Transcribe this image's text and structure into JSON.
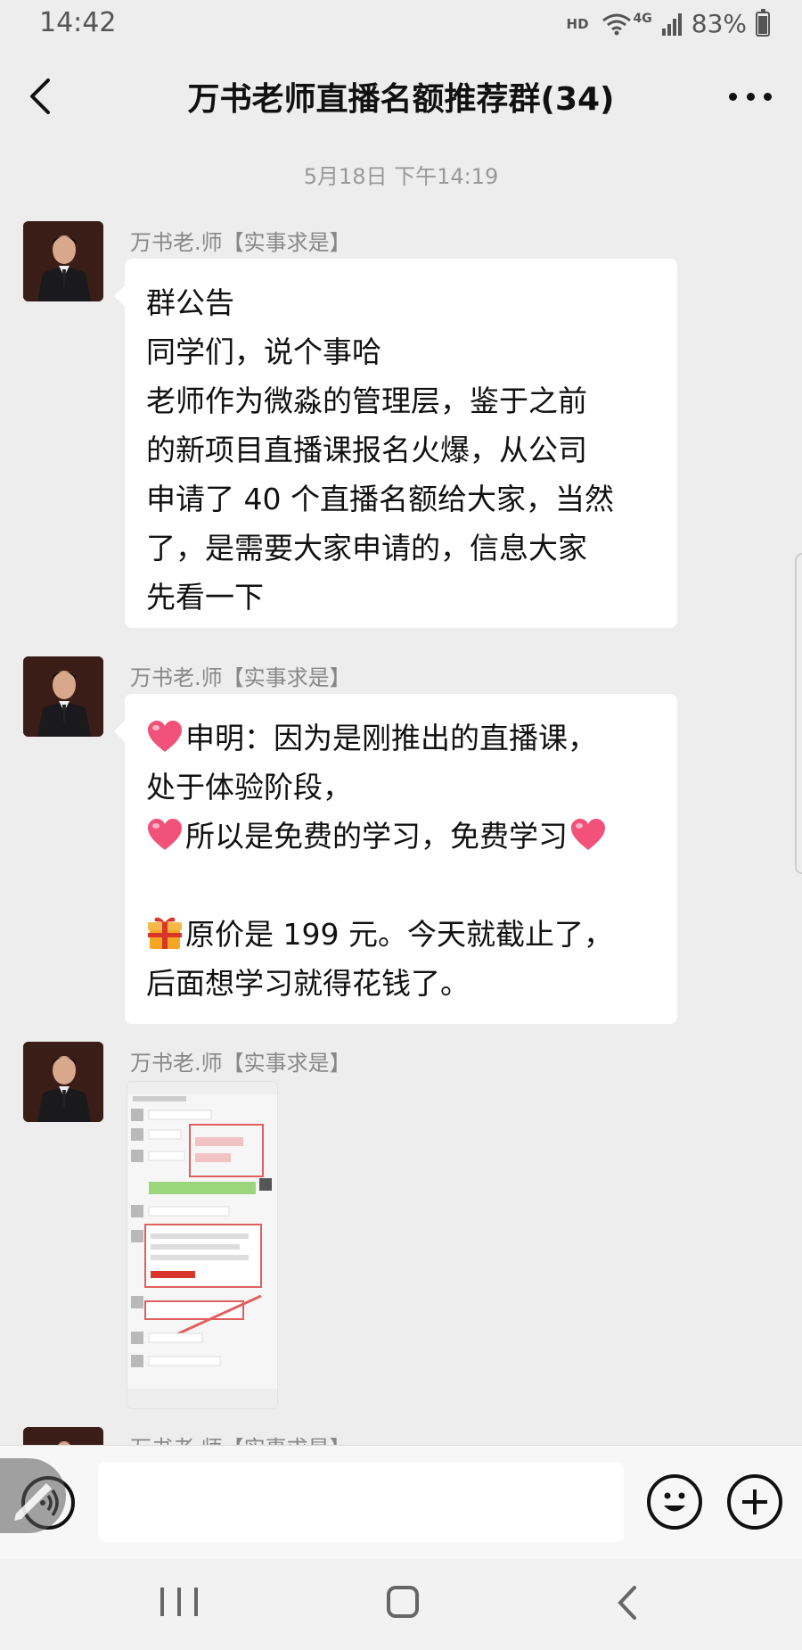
{
  "status_bar": {
    "time": "14:42",
    "hd": "HD",
    "network": "4G",
    "battery": "83%"
  },
  "header": {
    "title": "万书老师直播名额推荐群(34)"
  },
  "chat": {
    "timestamp": "5月18日 下午14:19",
    "messages": [
      {
        "sender": "万书老.师【实事求是】",
        "lines": [
          "群公告",
          "同学们，说个事哈",
          "老师作为微淼的管理层，鉴于之前",
          "的新项目直播课报名火爆，从公司",
          "申请了 40 个直播名额给大家，当然",
          "了，是需要大家申请的，信息大家",
          "先看一下"
        ]
      },
      {
        "sender": "万书老.师【实事求是】",
        "lines": [
          "申明：因为是刚推出的直播课，",
          "处于体验阶段，",
          "所以是免费的学习，免费学习",
          "",
          "原价是 199 元。今天就截止了，",
          "后面想学习就得花钱了。"
        ]
      },
      {
        "sender": "万书老.师【实事求是】",
        "type": "image"
      },
      {
        "sender": "万书老.师【实事求是】"
      }
    ]
  },
  "input": {
    "placeholder": ""
  },
  "icons": {
    "back": "back-arrow-icon",
    "more": "more-dots-icon",
    "voice": "voice-icon",
    "emoji": "emoji-icon",
    "plus": "plus-icon",
    "heart": "heart-icon",
    "gift": "gift-icon"
  },
  "colors": {
    "background": "#ededed",
    "bubble": "#ffffff",
    "heart": "#f2527a",
    "gift": "#f5a623"
  }
}
